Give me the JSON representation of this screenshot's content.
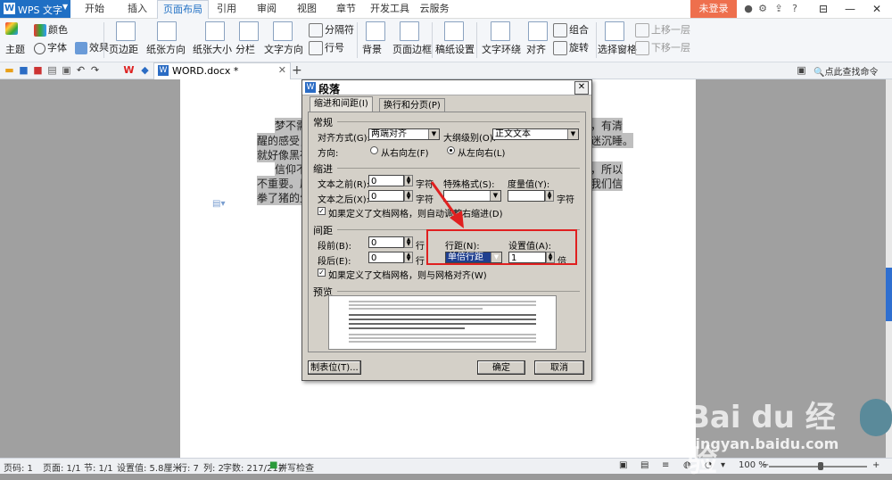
{
  "titlebar": {
    "app_name": "WPS 文字",
    "tabs": [
      "开始",
      "插入",
      "页面布局",
      "引用",
      "审阅",
      "视图",
      "章节",
      "开发工具",
      "云服务"
    ],
    "active_tab": "页面布局",
    "login_label": "未登录"
  },
  "ribbon": {
    "theme": "主题",
    "color": "颜色",
    "font": "字体",
    "effect": "效果",
    "margins": "页边距",
    "orientation": "纸张方向",
    "size": "纸张大小",
    "columns": "分栏",
    "text_direction": "文字方向",
    "breaks": "分隔符",
    "line_numbers": "行号",
    "background": "背景",
    "page_border": "页面边框",
    "manuscript": "稿纸设置",
    "text_wrap": "文字环绕",
    "align": "对齐",
    "group": "组合",
    "rotate": "旋转",
    "selection_pane": "选择窗格",
    "bring_forward": "上移一层",
    "send_backward": "下移一层"
  },
  "quickbar": {
    "doc_tab": "WORD.docx *",
    "find_command": "点此查找命令"
  },
  "document": {
    "lines": [
      "梦不需",
      "醒的感受，",
      "就好像黑夜",
      "信仰不",
      "不重要。原",
      "拳了猪的生",
      "，有清",
      "迷沉睡。",
      "，所以",
      "我们信"
    ]
  },
  "dialog": {
    "title": "段落",
    "tabs": [
      "缩进和间距(I)",
      "换行和分页(P)"
    ],
    "general": {
      "group": "常规",
      "align_label": "对齐方式(G):",
      "align_value": "两端对齐",
      "outline_label": "大纲级别(O):",
      "outline_value": "正文文本",
      "direction_label": "方向:",
      "rtl_label": "从右向左(F)",
      "ltr_label": "从左向右(L)"
    },
    "indent": {
      "group": "缩进",
      "before_label": "文本之前(R):",
      "before_value": "0",
      "before_unit": "字符",
      "after_label": "文本之后(X):",
      "after_value": "0",
      "after_unit": "字符",
      "special_label": "特殊格式(S):",
      "special_value": "",
      "measure_label": "度量值(Y):",
      "measure_value": "",
      "measure_unit": "字符",
      "grid_checkbox": "如果定义了文档网格，则自动调整右缩进(D)"
    },
    "spacing": {
      "group": "间距",
      "before_label": "段前(B):",
      "before_value": "0",
      "before_unit": "行",
      "after_label": "段后(E):",
      "after_value": "0",
      "after_unit": "行",
      "line_label": "行距(N):",
      "line_value": "单倍行距",
      "setting_label": "设置值(A):",
      "setting_value": "1",
      "setting_unit": "倍",
      "grid_checkbox": "如果定义了文档网格，则与网格对齐(W)"
    },
    "preview_group": "预览",
    "tabstops_button": "制表位(T)...",
    "ok_button": "确定",
    "cancel_button": "取消"
  },
  "statusbar": {
    "page_num": "页码: 1",
    "page": "页面: 1/1",
    "section": "节: 1/1",
    "setting": "设置值: 5.8厘米",
    "row": "行: 7",
    "col": "列: 2",
    "words": "字数: 217/217",
    "spell": "拼写检查",
    "zoom": "100 %"
  },
  "watermark": {
    "brand": "Bai du 经验",
    "url": "jingyan.baidu.com"
  },
  "colors": {
    "accent": "#1f6fc4",
    "login": "#ee6f4d",
    "highlight": "#e02020"
  }
}
